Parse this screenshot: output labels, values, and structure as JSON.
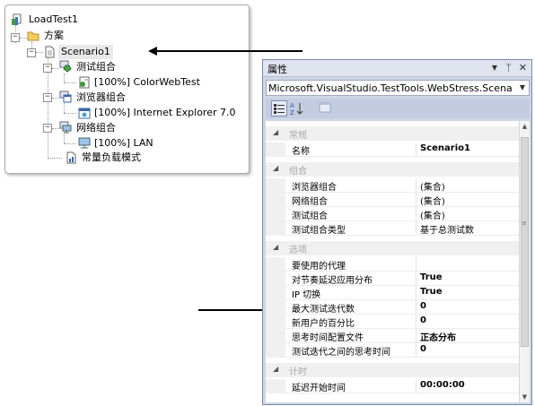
{
  "tree": {
    "root": "LoadTest1",
    "scenarios_folder": "方案",
    "scenario": "Scenario1",
    "test_mix": "测试组合",
    "test_item": "[100%] ColorWebTest",
    "browser_mix": "浏览器组合",
    "browser_item": "[100%] Internet Explorer 7.0",
    "network_mix": "网络组合",
    "network_item": "[100%] LAN",
    "load_pattern": "常量负载模式"
  },
  "properties_window": {
    "title": "属性",
    "pin_glyph": "▾ ᛘ ✕",
    "object_selector": "Microsoft.VisualStudio.TestTools.WebStress.Scenar...",
    "categories": [
      {
        "label": "常规",
        "rows": [
          {
            "name": "名称",
            "value": "Scenario1",
            "bold": true
          }
        ]
      },
      {
        "label": "组合",
        "rows": [
          {
            "name": "浏览器组合",
            "value": "(集合)",
            "bold": false
          },
          {
            "name": "网络组合",
            "value": "(集合)",
            "bold": false
          },
          {
            "name": "测试组合",
            "value": "(集合)",
            "bold": false
          },
          {
            "name": "测试组合类型",
            "value": "基于总测试数",
            "bold": false
          }
        ]
      },
      {
        "label": "选项",
        "rows": [
          {
            "name": "要使用的代理",
            "value": "",
            "bold": false
          },
          {
            "name": "对节奏延迟应用分布",
            "value": "True",
            "bold": true
          },
          {
            "name": "IP 切换",
            "value": "True",
            "bold": true
          },
          {
            "name": "最大测试迭代数",
            "value": "0",
            "bold": true
          },
          {
            "name": "新用户的百分比",
            "value": "0",
            "bold": true
          },
          {
            "name": "思考时间配置文件",
            "value": "正态分布",
            "bold": true
          },
          {
            "name": "测试迭代之间的思考时间",
            "value": "0",
            "bold": true
          }
        ]
      },
      {
        "label": "计时",
        "rows": [
          {
            "name": "延迟开始时间",
            "value": "00:00:00",
            "bold": true
          }
        ]
      }
    ]
  },
  "icons": {
    "root": "load-test-icon",
    "folder": "folder-icon",
    "scenario": "scenario-page-icon",
    "test_mix": "test-mix-icon",
    "web_test": "web-test-icon",
    "browser_mix": "browser-mix-icon",
    "browser": "browser-icon",
    "network_mix": "network-mix-icon",
    "network": "network-icon",
    "load_pattern": "load-pattern-icon"
  }
}
